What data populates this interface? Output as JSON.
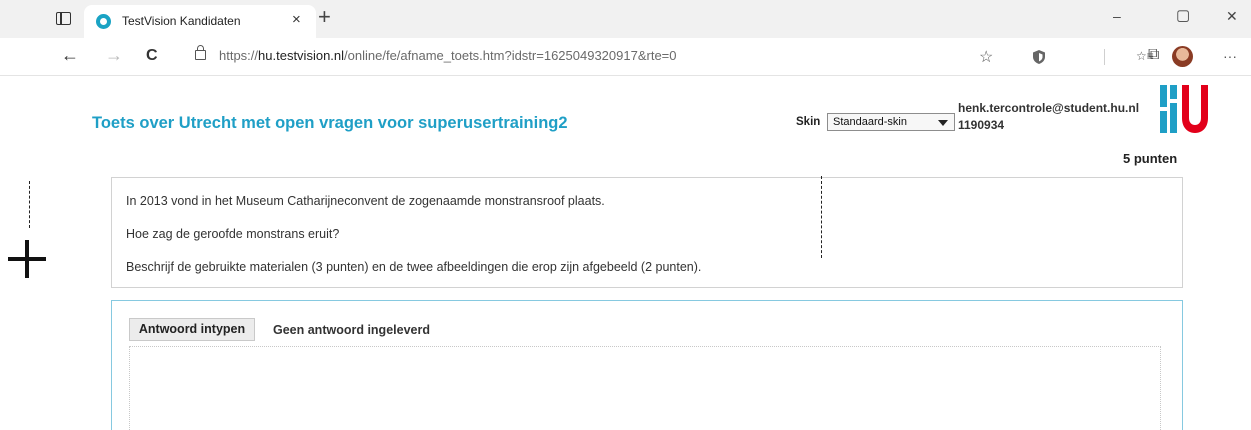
{
  "browser": {
    "tab_title": "TestVision Kandidaten",
    "tab_close": "×",
    "new_tab": "+",
    "win_minimize": "–",
    "win_maximize": "▢",
    "win_close": "✕",
    "back": "←",
    "forward": "→",
    "reload": "C",
    "url_scheme": "https://",
    "url_host": "hu.testvision.nl",
    "url_path": "/online/fe/afname_toets.htm?idstr=1625049320917&rte=0",
    "more_menu": "···",
    "favorites_star": "☆",
    "collections": "⧉",
    "favorites_list": "☆≡"
  },
  "header": {
    "test_title": "Toets over Utrecht met open vragen voor superusertraining2",
    "skin_label": "Skin",
    "skin_selected": "Standaard-skin",
    "user_email": "henk.tercontrole@student.hu.nl",
    "user_id": "1190934",
    "logo_text": "HU"
  },
  "question": {
    "points": "5 punten",
    "lines": [
      "In 2013 vond in het Museum Catharijneconvent de zogenaamde monstransroof plaats.",
      "Hoe zag de geroofde monstrans eruit?",
      "Beschrijf de gebruikte materialen (3 punten) en de twee afbeeldingen die erop zijn afgebeeld (2 punten)."
    ]
  },
  "answer": {
    "type_button": "Antwoord intypen",
    "status": "Geen antwoord ingeleverd"
  },
  "colors": {
    "title_blue": "#1f9fc6",
    "logo_blue": "#1f9fc6",
    "logo_red": "#e2001a",
    "answer_border": "#86c9e0"
  }
}
